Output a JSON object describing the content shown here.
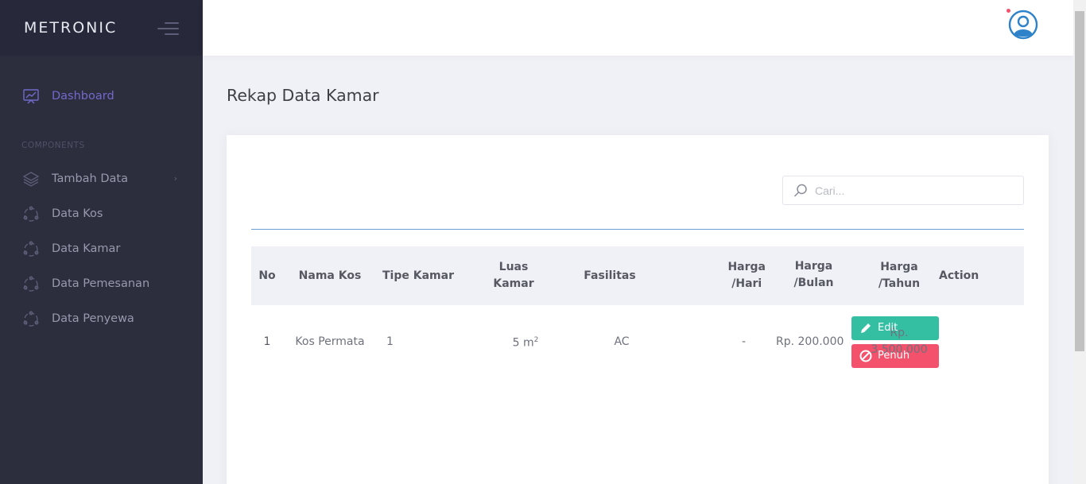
{
  "brand": {
    "name": "METRONIC"
  },
  "sidebar": {
    "section_label": "COMPONENTS",
    "items": [
      {
        "label": "Dashboard",
        "icon": "chart-board-icon",
        "active": true
      },
      {
        "label": "Tambah Data",
        "icon": "layers-icon",
        "has_children": true
      },
      {
        "label": "Data Kos",
        "icon": "circle-nodes-icon"
      },
      {
        "label": "Data Kamar",
        "icon": "circle-nodes-icon"
      },
      {
        "label": "Data Pemesanan",
        "icon": "circle-nodes-icon"
      },
      {
        "label": "Data Penyewa",
        "icon": "circle-nodes-icon"
      }
    ],
    "chevron": "›"
  },
  "header": {
    "avatar_icon": "user-avatar-icon"
  },
  "page": {
    "title": "Rekap Data Kamar"
  },
  "search": {
    "placeholder": "Cari...",
    "value": ""
  },
  "table": {
    "headers": {
      "no": "No",
      "nama_kos": "Nama Kos",
      "tipe_kamar": "Tipe Kamar",
      "luas_kamar_1": "Luas",
      "luas_kamar_2": "Kamar",
      "fasilitas": "Fasilitas",
      "harga_hari_1": "Harga",
      "harga_hari_2": "/Hari",
      "harga_bulan_1": "Harga",
      "harga_bulan_2": "/Bulan",
      "harga_tahun_1": "Harga",
      "harga_tahun_2": "/Tahun",
      "action": "Action"
    },
    "rows": [
      {
        "no": "1",
        "nama_kos": "Kos Permata",
        "tipe_kamar": "1",
        "luas": "5 m",
        "luas_sup": "2",
        "fasilitas": "AC",
        "harga_hari": "-",
        "harga_bulan": "Rp. 200.000",
        "harga_tahun_1": "Rp.",
        "harga_tahun_2": "3.500.000",
        "edit_label": "Edit",
        "full_label": "Penuh"
      }
    ]
  },
  "colors": {
    "sidebar_bg": "#2c2e3e",
    "accent": "#716aca",
    "edit": "#34bfa3",
    "danger": "#f4516c",
    "divider": "#6a9fd6"
  }
}
